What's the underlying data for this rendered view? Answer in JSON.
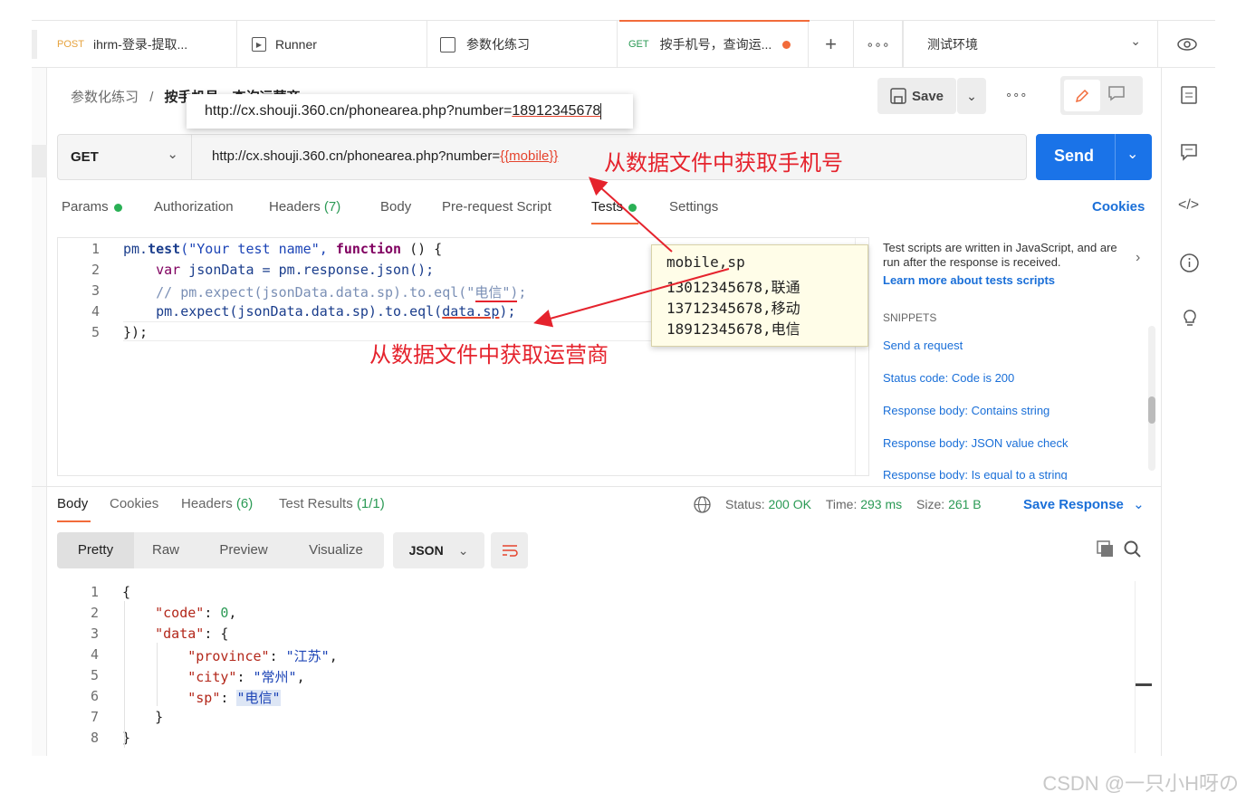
{
  "tabs": [
    {
      "method": "POST",
      "label": "ihrm-登录-提取..."
    },
    {
      "label": "Runner"
    },
    {
      "label": "参数化练习"
    },
    {
      "method": "GET",
      "label": "按手机号，查询运..."
    }
  ],
  "environment": "测试环境",
  "breadcrumb": {
    "collection": "参数化练习",
    "separator": "/",
    "request": "按手机号，查询运营商"
  },
  "toolbar": {
    "save_label": "Save"
  },
  "request": {
    "method": "GET",
    "url_prefix": "http://cx.shouji.360.cn/phonearea.php?number=",
    "url_variable": "{{mobile}}",
    "send_label": "Send"
  },
  "url_popup": {
    "prefix": "http://cx.shouji.360.cn/phonearea.php?number=",
    "number": "18912345678"
  },
  "request_tabs": {
    "params": "Params",
    "authorization": "Authorization",
    "headers": "Headers",
    "headers_count": "(7)",
    "body": "Body",
    "pre_request": "Pre-request Script",
    "tests": "Tests",
    "settings": "Settings",
    "cookies": "Cookies"
  },
  "code_lines": {
    "l1a": "pm.",
    "l1b": "test",
    "l1c": "(\"Your test name\", ",
    "l1d": "function",
    "l1e": " () {",
    "l2a": "    ",
    "l2b": "var",
    "l2c": " jsonData = pm.response.json();",
    "l3": "    // pm.expect(jsonData.data.sp).to.eql(\"电信\");",
    "l4a": "    pm.expect(jsonData.data.sp).to.eql(",
    "l4b": "data.sp",
    "l4c": ");",
    "l5": "});"
  },
  "line_numbers": [
    "1",
    "2",
    "3",
    "4",
    "5"
  ],
  "tests_panel": {
    "intro": "Test scripts are written in JavaScript, and are run after the response is received.",
    "learn_link": "Learn more about tests scripts",
    "snippets_header": "SNIPPETS",
    "snippets": [
      "Send a request",
      "Status code: Code is 200",
      "Response body: Contains string",
      "Response body: JSON value check",
      "Response body: Is equal to a string"
    ]
  },
  "csv": [
    "mobile,sp",
    "13012345678,联通",
    "13712345678,移动",
    "18912345678,电信"
  ],
  "annotations": {
    "url": "从数据文件中获取手机号",
    "body": "从数据文件中获取运营商"
  },
  "response": {
    "tabs": {
      "body": "Body",
      "cookies": "Cookies",
      "headers": "Headers",
      "headers_count": "(6)",
      "test_results": "Test Results",
      "test_count": "(1/1)"
    },
    "status_label": "Status:",
    "status": "200 OK",
    "time_label": "Time:",
    "time": "293 ms",
    "size_label": "Size:",
    "size": "261 B",
    "save_response": "Save Response",
    "formats": [
      "Pretty",
      "Raw",
      "Preview",
      "Visualize"
    ],
    "format_type": "JSON",
    "json_lines": {
      "l1": "{",
      "l2k": "\"code\"",
      "l2v": "0",
      "l3k": "\"data\"",
      "l4k": "\"province\"",
      "l4v": "\"江苏\"",
      "l5k": "\"city\"",
      "l5v": "\"常州\"",
      "l6k": "\"sp\"",
      "l6v": "\"电信\"",
      "l7": "}",
      "l8": "}"
    },
    "line_numbers": [
      "1",
      "2",
      "3",
      "4",
      "5",
      "6",
      "7",
      "8"
    ]
  },
  "watermark": "CSDN @一只小H呀の"
}
